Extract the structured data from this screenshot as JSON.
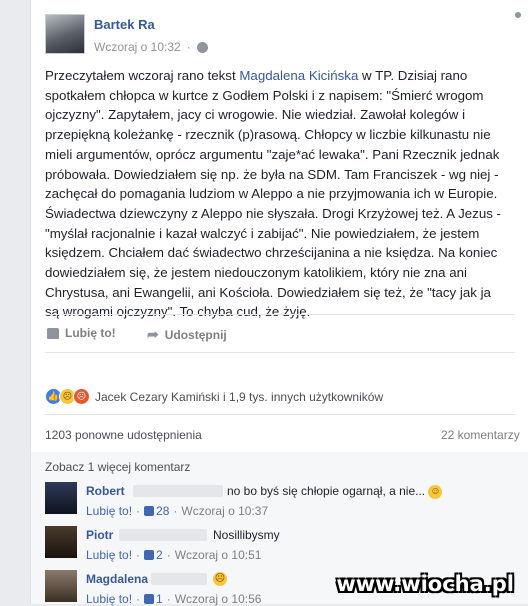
{
  "post": {
    "author": "Bartek Ra",
    "timestamp": "Wczoraj o 10:32",
    "text_before_mention": "Przeczytałem wczoraj rano tekst ",
    "mention": "Magdalena Kicińska",
    "text_after_mention": " w TP. Dzisiaj rano spotkałem chłopca w kurtce z Godłem Polski i z napisem: \"Śmierć wrogom ojczyzny\". Zapytałem, jacy ci wrogowie. Nie wiedział. Zawołał kolegów i przepiękną koleżankę - rzecznik (p)rasową. Chłopcy w liczbie kilkunastu nie mieli argumentów, oprócz argumentu \"zaje*ać lewaka\". Pani Rzecznik jednak próbowała. Dowiedziałem się np. że była na SDM. Tam Franciszek - wg niej - zachęcał do pomagania ludziom w Aleppo a nie przyjmowania ich w Europie. Świadectwa dziewczyny z Aleppo nie słyszała. Drogi Krzyżowej też. A Jezus - \"myślał racjonalnie i kazał walczyć i zabijać\". Nie powiedziałem, że jestem księdzem. Chciałem dać świadectwo chrześcijanina a nie księdza. Na koniec dowiedziałem się, że jestem niedouczonym katolikiem, który nie zna ani Chrystusa, ani Ewangelii, ani Kościoła. Dowiedziałem się też, że \"tacy jak ja są wrogami ojczyzny\". To chyba cud, że żyję."
  },
  "actions": {
    "like": "Lubię to!",
    "share": "Udostępnij"
  },
  "reactions": {
    "summary": "Jacek Cezary Kamiński i 1,9 tys. innych użytkowników"
  },
  "stats": {
    "shares": "1203 ponowne udostępnienia",
    "comments": "22 komentarzy"
  },
  "comments_section": {
    "more_label": "Zobacz 1 więcej komentarz",
    "like_label": "Lubię to!",
    "items": [
      {
        "name": "Robert",
        "text": "no bo byś się chłopie ogarnął, a nie...",
        "likes": "28",
        "time": "Wczoraj o 10:37"
      },
      {
        "name": "Piotr",
        "text": "Nosillibysmy",
        "likes": "2",
        "time": "Wczoraj o 10:51"
      },
      {
        "name": "Magdalena",
        "text": "",
        "likes": "1",
        "time": "Wczoraj o 10:56"
      }
    ]
  },
  "watermark": "www.wiocha.pl",
  "colors": {
    "link": "#365899",
    "background": "#e9ebee",
    "card": "#ffffff"
  }
}
